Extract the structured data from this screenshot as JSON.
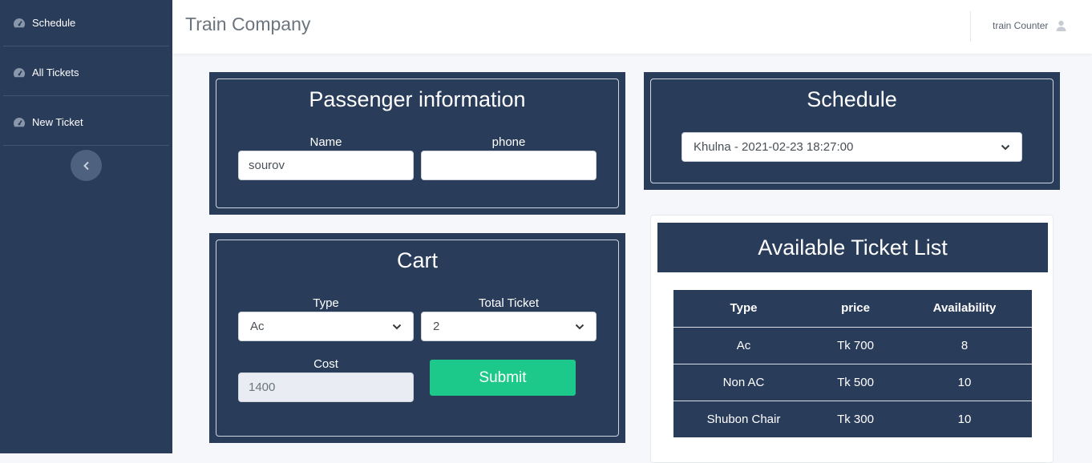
{
  "sidebar": {
    "items": [
      {
        "label": "Schedule",
        "icon": "tachometer-icon"
      },
      {
        "label": "All Tickets",
        "icon": "tachometer-icon"
      },
      {
        "label": "New Ticket",
        "icon": "tachometer-icon"
      }
    ],
    "collapse_icon": "chevron-left-icon"
  },
  "header": {
    "title": "Train Company",
    "user_name": "train Counter",
    "user_icon": "user-icon"
  },
  "passenger": {
    "title": "Passenger information",
    "name_label": "Name",
    "name_value": "sourov",
    "phone_label": "phone",
    "phone_value": ""
  },
  "schedule": {
    "title": "Schedule",
    "selected": "Khulna - 2021-02-23 18:27:00"
  },
  "cart": {
    "title": "Cart",
    "type_label": "Type",
    "type_value": "Ac",
    "total_label": "Total Ticket",
    "total_value": "2",
    "cost_label": "Cost",
    "cost_value": "1400",
    "submit_label": "Submit"
  },
  "tickets": {
    "title": "Available Ticket List",
    "columns": [
      "Type",
      "price",
      "Availability"
    ],
    "rows": [
      [
        "Ac",
        "Tk 700",
        "8"
      ],
      [
        "Non AC",
        "Tk 500",
        "10"
      ],
      [
        "Shubon Chair",
        "Tk 300",
        "10"
      ]
    ]
  },
  "colors": {
    "navy": "#293c5a",
    "accent_green": "#1cc88a",
    "page_bg": "#f5f7fb"
  }
}
